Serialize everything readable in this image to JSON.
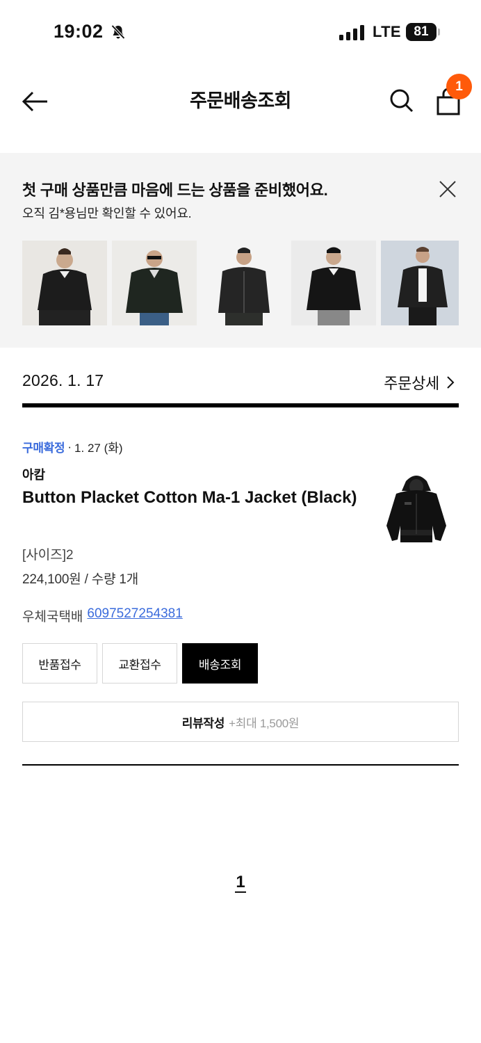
{
  "status_bar": {
    "time": "19:02",
    "network": "LTE",
    "battery": "81",
    "icons": [
      "bell-off-icon",
      "signal-icon",
      "battery-icon"
    ]
  },
  "header": {
    "title": "주문배송조회",
    "cart_count": "1",
    "icons": [
      "back-arrow-icon",
      "search-icon",
      "shopping-bag-icon"
    ],
    "badge_color": "#ff5a0a"
  },
  "recommendation": {
    "title": "첫 구매 상품만큼 마음에 드는 상품을 준비했어요.",
    "subtitle": "오직 김*용님만 확인할 수 있어요.",
    "close_icon": "close-icon",
    "thumbnails": [
      "leather-jacket-1",
      "leather-jacket-2",
      "leather-jacket-3",
      "leather-jacket-4",
      "leather-jacket-5"
    ]
  },
  "order": {
    "date": "2026. 1. 17",
    "detail_label": "주문상세",
    "status": "구매확정",
    "status_separator": "·",
    "status_date": "1. 27 (화)",
    "brand": "아캄",
    "product_name": "Button Placket Cotton Ma-1 Jacket (Black)",
    "option": "[사이즈]2",
    "price_qty": "224,100원 / 수량 1개",
    "courier": "우체국택배",
    "tracking_number": "6097527254381",
    "accent_color": "#3a6bdc"
  },
  "actions": {
    "return_label": "반품접수",
    "exchange_label": "교환접수",
    "tracking_label": "배송조회",
    "review_label": "리뷰작성",
    "review_reward": "+최대 1,500원"
  },
  "pagination": {
    "current_page": "1"
  }
}
